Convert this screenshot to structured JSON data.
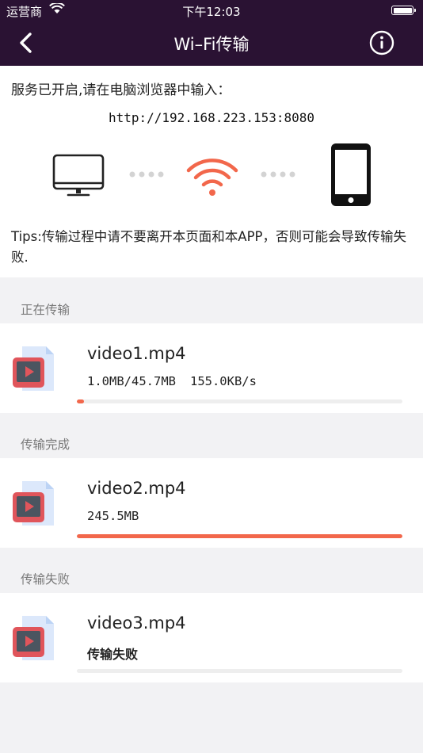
{
  "status_bar": {
    "carrier": "运营商",
    "time": "下午12:03"
  },
  "nav": {
    "title": "Wi–Fi传输"
  },
  "connection": {
    "instruction": "服务已开启,请在电脑浏览器中输入：",
    "url": "http://192.168.223.153:8080",
    "tips": "Tips:传输过程中请不要离开本页面和本APP，否则可能会导致传输失败."
  },
  "colors": {
    "header_bg": "#2a1233",
    "accent": "#f2674b",
    "section_bg": "#f2f2f4"
  },
  "icons": [
    "back-icon",
    "info-icon",
    "monitor-icon",
    "wifi-icon",
    "phone-icon",
    "video-file-icon"
  ],
  "sections": {
    "transferring": {
      "header": "正在传输",
      "item": {
        "name": "video1.mp4",
        "size": "1.0MB/45.7MB",
        "speed": "155.0KB/s",
        "progress": 0.022
      }
    },
    "completed": {
      "header": "传输完成",
      "item": {
        "name": "video2.mp4",
        "size": "245.5MB",
        "progress": 1.0
      }
    },
    "failed": {
      "header": "传输失败",
      "item": {
        "name": "video3.mp4",
        "status": "传输失败",
        "progress": 0.0
      }
    }
  }
}
